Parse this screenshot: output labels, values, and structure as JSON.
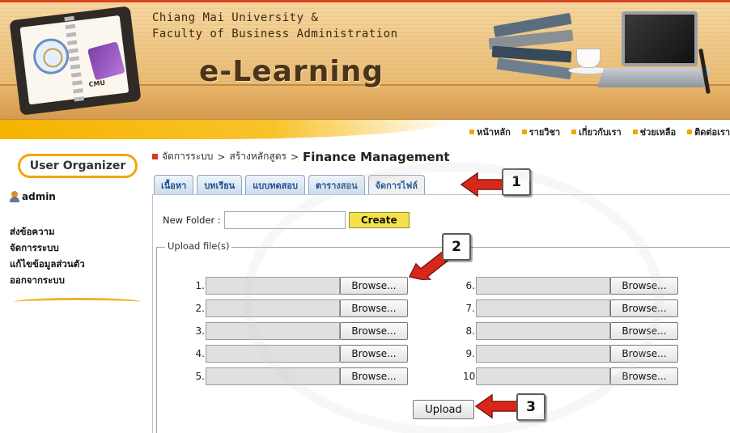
{
  "banner": {
    "university_line1": "Chiang Mai University &",
    "university_line2": "Faculty of Business Administration",
    "app_title": "e-Learning",
    "logo_text": "CMU"
  },
  "top_nav": [
    {
      "label": "หน้าหลัก"
    },
    {
      "label": "รายวิชา"
    },
    {
      "label": "เกี่ยวกับเรา"
    },
    {
      "label": "ช่วยเหลือ"
    },
    {
      "label": "ติดต่อเรา"
    }
  ],
  "sidebar": {
    "header": "User Organizer",
    "username": "admin",
    "links": [
      {
        "label": "ส่งข้อความ"
      },
      {
        "label": "จัดการระบบ"
      },
      {
        "label": "แก้ไขข้อมูลส่วนตัว"
      },
      {
        "label": "ออกจากระบบ"
      }
    ]
  },
  "breadcrumb": {
    "items": [
      "จัดการระบบ",
      "สร้างหลักสูตร"
    ],
    "separator": ">",
    "current": "Finance Management"
  },
  "tabs": [
    {
      "label": "เนื้อหา",
      "active": false
    },
    {
      "label": "บทเรียน",
      "active": false
    },
    {
      "label": "แบบทดสอบ",
      "active": false
    },
    {
      "label": "ตารางสอน",
      "active": false
    },
    {
      "label": "จัดการไฟล์",
      "active": true
    }
  ],
  "new_folder": {
    "label": "New Folder :",
    "value": "",
    "button": "Create"
  },
  "upload": {
    "legend": "Upload file(s)",
    "browse_label": "Browse...",
    "rows": [
      {
        "num": "1."
      },
      {
        "num": "2."
      },
      {
        "num": "3."
      },
      {
        "num": "4."
      },
      {
        "num": "5."
      },
      {
        "num": "6."
      },
      {
        "num": "7."
      },
      {
        "num": "8."
      },
      {
        "num": "9."
      },
      {
        "num": "10."
      }
    ],
    "submit": "Upload"
  },
  "callouts": [
    "1",
    "2",
    "3"
  ],
  "colors": {
    "accent_orange": "#f3a60b",
    "tab_text": "#1e4f8f",
    "create_button": "#f5e24a",
    "arrow_red": "#d9281b"
  }
}
